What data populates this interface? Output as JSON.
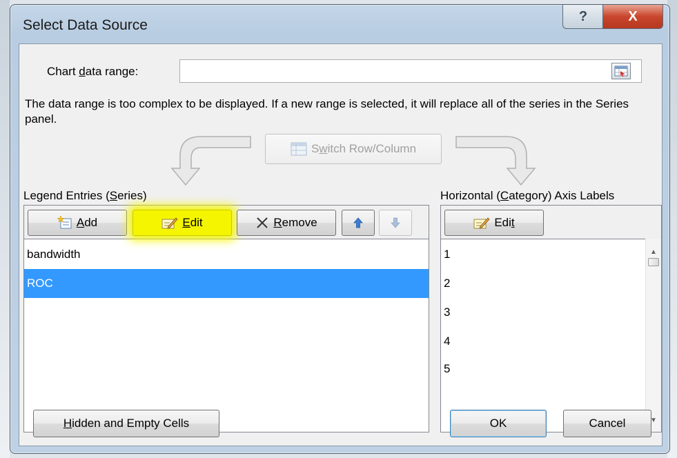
{
  "window": {
    "title": "Select Data Source",
    "help_label": "?",
    "close_label": "X"
  },
  "range": {
    "label_pre": "Chart ",
    "label_u": "d",
    "label_post": "ata range:",
    "value": ""
  },
  "message": "The data range is too complex to be displayed. If a new range is selected, it will replace all of the series in the Series panel.",
  "switch": {
    "pre": "S",
    "u": "w",
    "post": "itch Row/Column"
  },
  "legend": {
    "label_pre": "Legend Entries (",
    "label_u": "S",
    "label_post": "eries)",
    "add": {
      "u": "A",
      "post": "dd"
    },
    "edit": {
      "u": "E",
      "post": "dit"
    },
    "remove": {
      "u": "R",
      "post": "emove"
    },
    "items": [
      "bandwidth",
      "ROC"
    ],
    "selected_index": 1
  },
  "axis": {
    "label_pre": "Horizontal (",
    "label_u": "C",
    "label_post": "ategory) Axis Labels",
    "edit": {
      "pre": "Edi",
      "u": "t"
    },
    "items": [
      "1",
      "2",
      "3",
      "4",
      "5"
    ]
  },
  "footer": {
    "hidden": {
      "u": "H",
      "post": "idden and Empty Cells"
    },
    "ok": "OK",
    "cancel": "Cancel"
  },
  "colors": {
    "selection": "#3399ff",
    "highlight": "#f5f500",
    "close_red": "#c9462c"
  }
}
